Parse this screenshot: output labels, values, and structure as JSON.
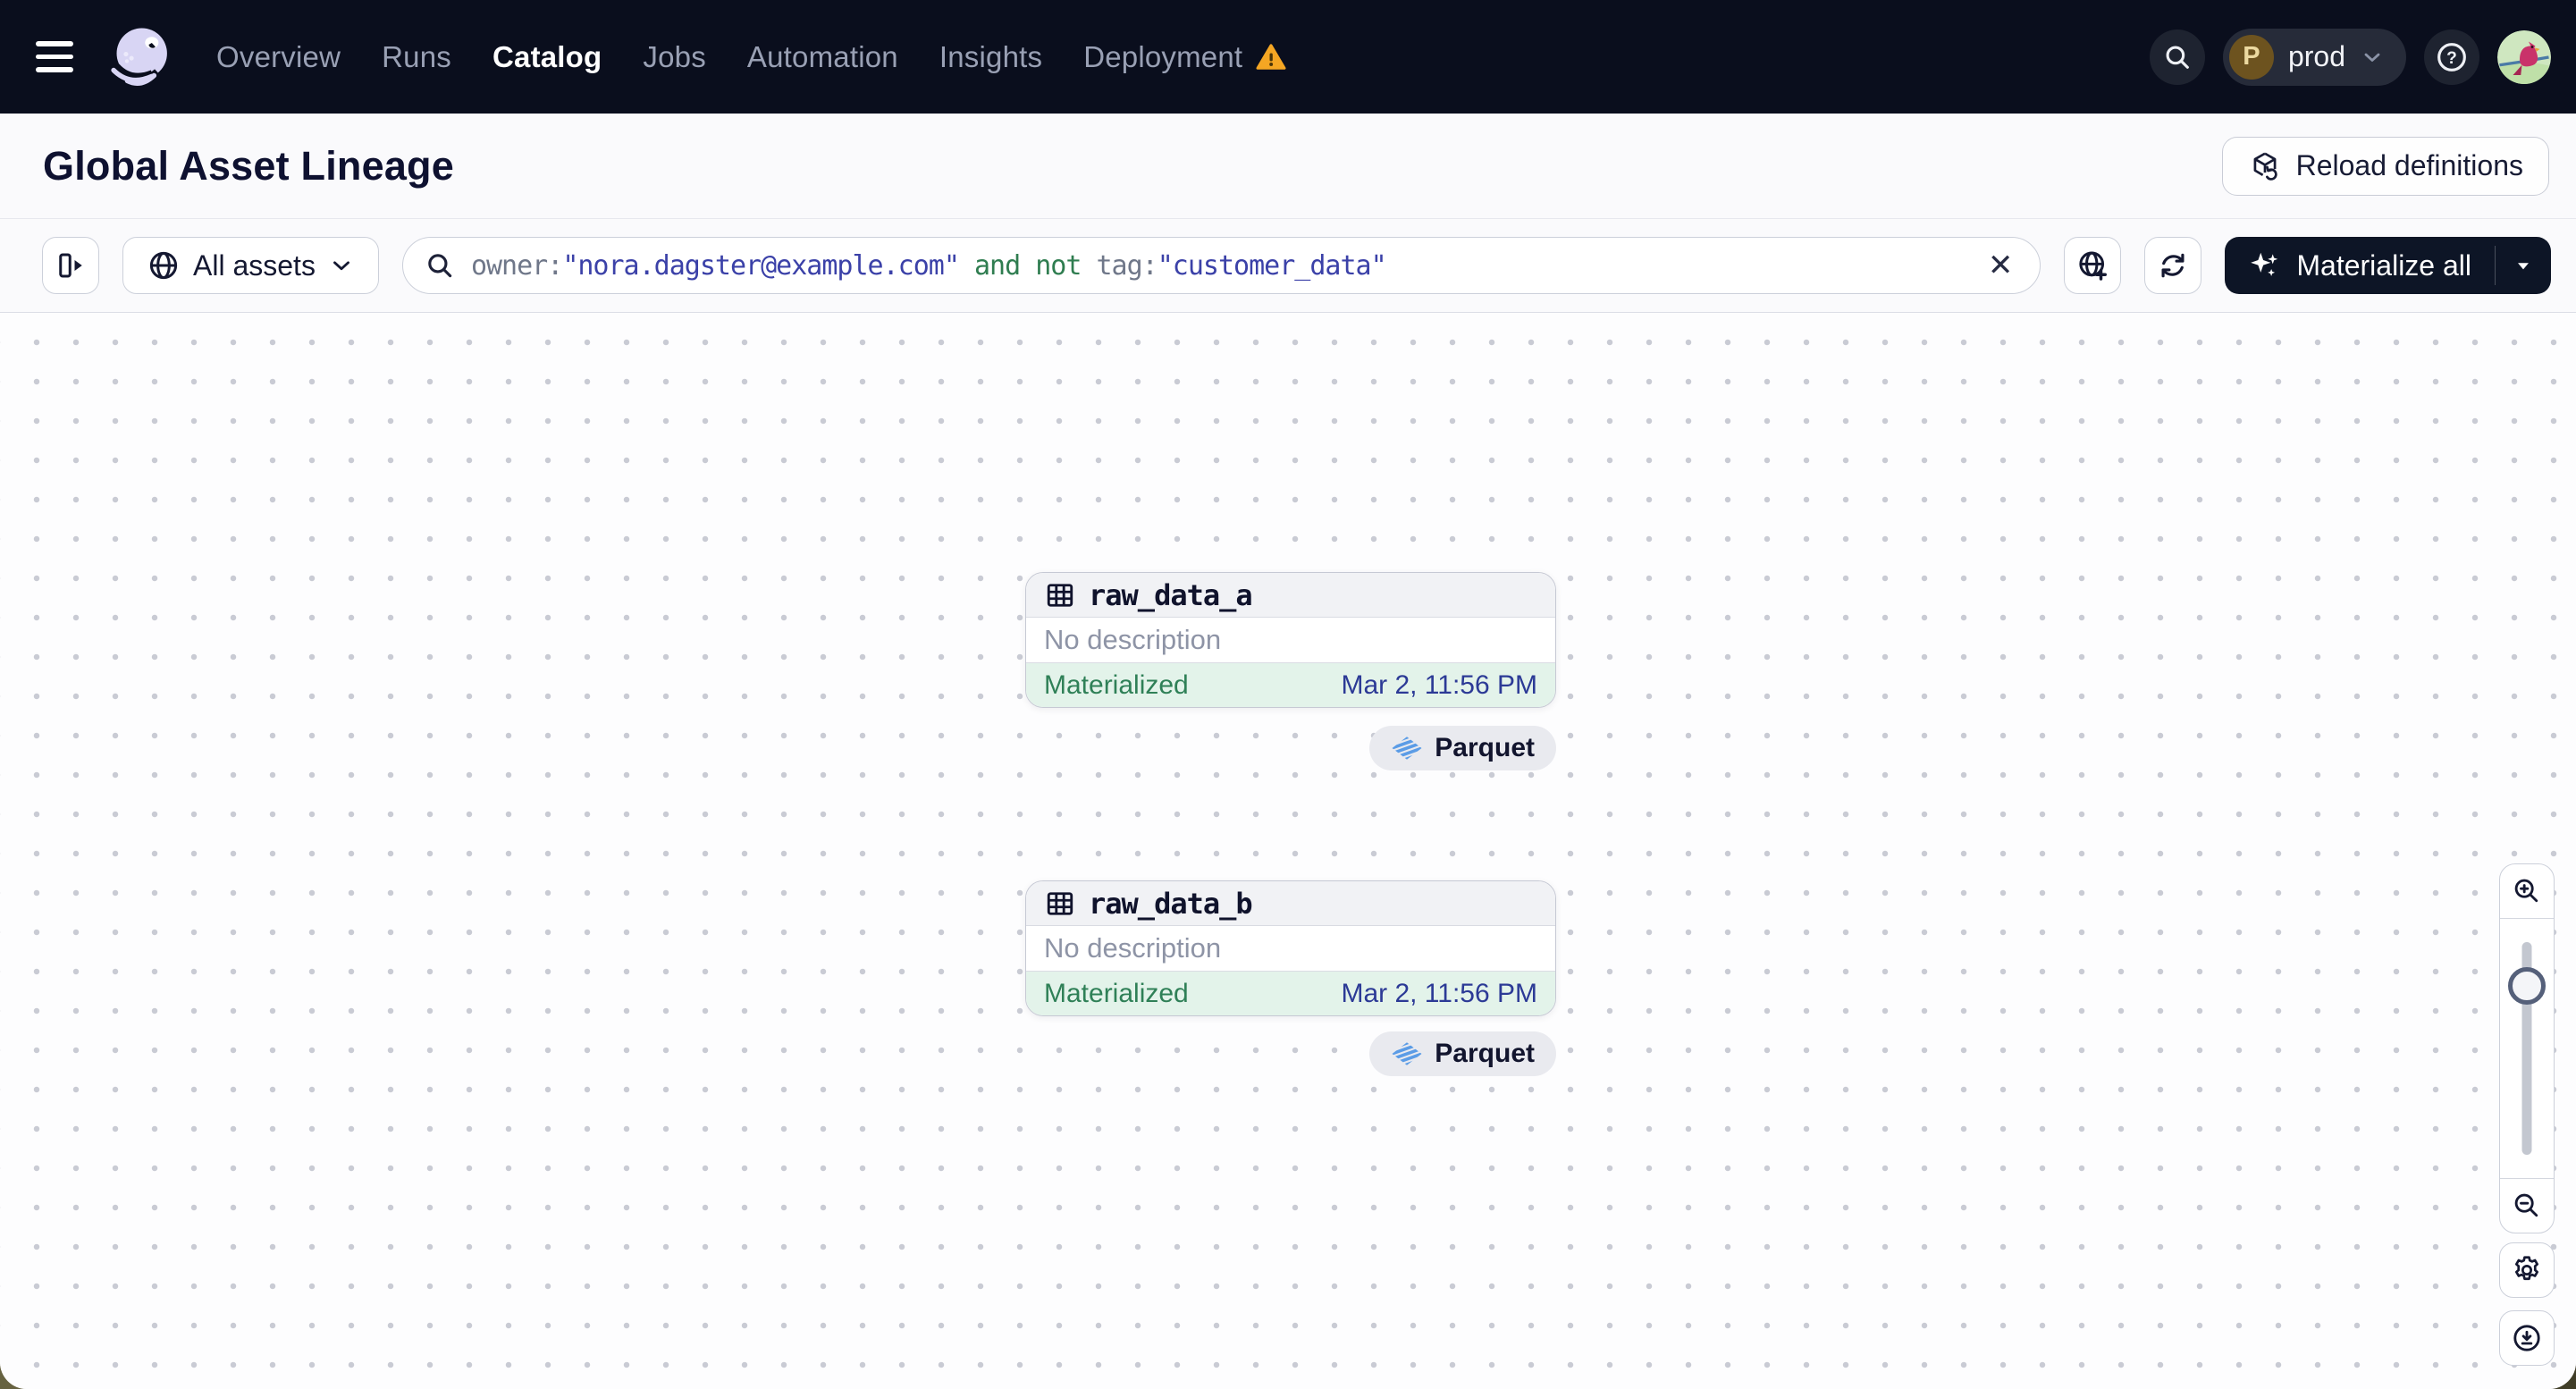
{
  "nav": {
    "items": [
      {
        "label": "Overview",
        "active": false
      },
      {
        "label": "Runs",
        "active": false
      },
      {
        "label": "Catalog",
        "active": true
      },
      {
        "label": "Jobs",
        "active": false
      },
      {
        "label": "Automation",
        "active": false
      },
      {
        "label": "Insights",
        "active": false
      },
      {
        "label": "Deployment",
        "active": false,
        "warning": true
      }
    ],
    "environment": {
      "initial": "P",
      "label": "prod"
    },
    "icons": {
      "help": "?",
      "clear": "✕"
    }
  },
  "header": {
    "title": "Global Asset Lineage",
    "reload_label": "Reload definitions"
  },
  "toolbar": {
    "scope_label": "All assets",
    "materialize_label": "Materialize all",
    "query": {
      "segments": [
        "owner:",
        "\"nora.dagster@example.com\"",
        " and not ",
        "tag:",
        "\"customer_data\""
      ]
    }
  },
  "nodes": [
    {
      "name": "raw_data_a",
      "description": "No description",
      "status": "Materialized",
      "timestamp": "Mar 2, 11:56 PM",
      "kind": "Parquet"
    },
    {
      "name": "raw_data_b",
      "description": "No description",
      "status": "Materialized",
      "timestamp": "Mar 2, 11:56 PM",
      "kind": "Parquet"
    }
  ],
  "colors": {
    "nav_bg": "#0a0e1d",
    "accent_indigo": "#3b41a8",
    "query_operator_green": "#2f7d50",
    "status_green_bg": "#e3f3ea",
    "status_green_text": "#2f8057",
    "timestamp_blue": "#2c3a96",
    "warning_orange": "#f5a623",
    "logo_lavender": "#d8d5f4",
    "parquet_blue": "#5b9ce6"
  }
}
